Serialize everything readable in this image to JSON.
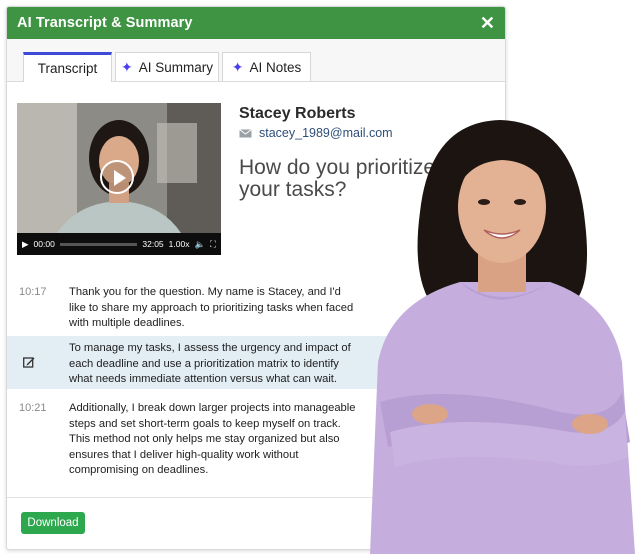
{
  "window": {
    "title": "AI Transcript & Summary",
    "close_icon": "close-icon"
  },
  "tabs": [
    {
      "label": "Transcript",
      "active": true
    },
    {
      "label": "AI Summary",
      "icon": "sparkle-icon"
    },
    {
      "label": "AI Notes",
      "icon": "sparkle-icon"
    }
  ],
  "video": {
    "current_time": "00:00",
    "duration": "32:05",
    "speed": "1.00x",
    "progress": 0.0
  },
  "candidate": {
    "name": "Stacey Roberts",
    "email": "stacey_1989@mail.com"
  },
  "question": "How do you prioritize your tasks?",
  "transcript": [
    {
      "time": "10:17",
      "text": "Thank you for the question. My name is Stacey, and I'd like to share my approach to prioritizing tasks when faced with multiple deadlines."
    },
    {
      "time": "",
      "text": "To manage my tasks, I assess the urgency and impact of each deadline and use a prioritization matrix to identify what needs immediate attention versus what can wait.",
      "highlighted": true
    },
    {
      "time": "10:21",
      "text": "Additionally, I break down larger projects into manageable steps and set short-term goals to keep myself on track. This method not only helps me stay organized but also ensures that I deliver high-quality work without compromising on deadlines."
    }
  ],
  "footer": {
    "download_label": "Download"
  },
  "colors": {
    "header": "#3f9443",
    "tab_accent": "#3b4bd8",
    "download": "#2ea84e",
    "highlight": "#e2edf4"
  }
}
